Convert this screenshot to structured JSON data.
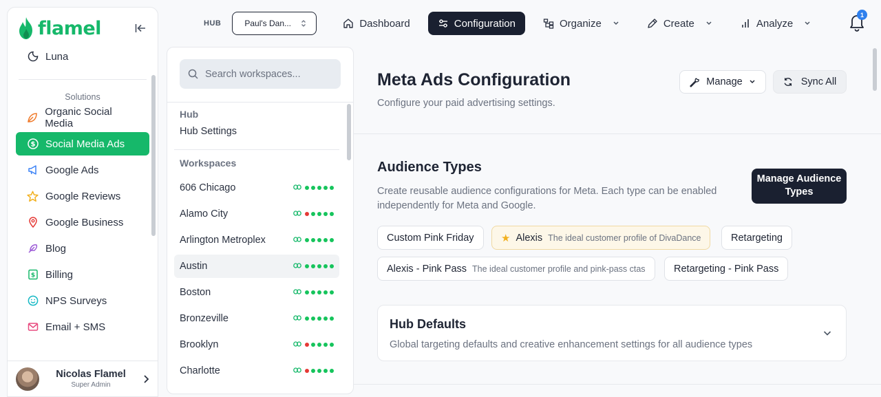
{
  "brand": {
    "name": "flamel",
    "color": "#16b86a"
  },
  "sidebar": {
    "top_item": {
      "label": "Luna",
      "icon": "moon-icon"
    },
    "section_label": "Solutions",
    "items": [
      {
        "label": "Organic Social Media",
        "icon": "leaf-icon",
        "color": "#f07a2a"
      },
      {
        "label": "Social Media Ads",
        "icon": "dollar-icon",
        "active": true
      },
      {
        "label": "Google Ads",
        "icon": "megaphone-icon",
        "color": "#3b82f6"
      },
      {
        "label": "Google Reviews",
        "icon": "star-icon",
        "color": "#f2b01e"
      },
      {
        "label": "Google Business",
        "icon": "map-pin-icon",
        "color": "#e53935"
      },
      {
        "label": "Blog",
        "icon": "feather-icon",
        "color": "#9b59d6"
      },
      {
        "label": "Billing",
        "icon": "billing-icon",
        "color": "#16b86a"
      },
      {
        "label": "NPS Surveys",
        "icon": "smile-icon",
        "color": "#14b8c4"
      },
      {
        "label": "Email + SMS",
        "icon": "mail-icon",
        "color": "#e84a7f"
      }
    ],
    "user": {
      "name": "Nicolas Flamel",
      "role": "Super Admin"
    }
  },
  "topbar": {
    "hub_label": "HUB",
    "hub_value": "Paul's Dan...",
    "tabs": [
      {
        "label": "Dashboard",
        "icon": "home-icon"
      },
      {
        "label": "Configuration",
        "icon": "sliders-icon",
        "active": true
      },
      {
        "label": "Organize",
        "icon": "organize-icon",
        "dropdown": true
      },
      {
        "label": "Create",
        "icon": "pen-icon",
        "dropdown": true
      },
      {
        "label": "Analyze",
        "icon": "bar-chart-icon",
        "dropdown": true
      }
    ],
    "notifications": "1"
  },
  "workspace_panel": {
    "search_placeholder": "Search workspaces...",
    "hub_heading": "Hub",
    "hub_settings": "Hub Settings",
    "workspaces_heading": "Workspaces",
    "workspaces": [
      {
        "name": "606 Chicago",
        "dots": [
          "green",
          "green",
          "green",
          "green",
          "green"
        ]
      },
      {
        "name": "Alamo City",
        "dots": [
          "red",
          "green",
          "green",
          "green",
          "green"
        ]
      },
      {
        "name": "Arlington Metroplex",
        "dots": [
          "green",
          "green",
          "green",
          "green",
          "green"
        ]
      },
      {
        "name": "Austin",
        "dots": [
          "green",
          "green",
          "green",
          "green",
          "green"
        ],
        "highlighted": true
      },
      {
        "name": "Boston",
        "dots": [
          "green",
          "green",
          "green",
          "green",
          "green"
        ]
      },
      {
        "name": "Bronzeville",
        "dots": [
          "green",
          "green",
          "green",
          "green",
          "green"
        ]
      },
      {
        "name": "Brooklyn",
        "dots": [
          "red",
          "green",
          "green",
          "green",
          "green"
        ]
      },
      {
        "name": "Charlotte",
        "dots": [
          "red",
          "green",
          "green",
          "green",
          "green"
        ]
      }
    ]
  },
  "main": {
    "title": "Meta Ads Configuration",
    "subtitle": "Configure your paid advertising settings.",
    "manage_label": "Manage",
    "sync_label": "Sync All",
    "audience": {
      "title": "Audience Types",
      "description": "Create reusable audience configurations for Meta. Each type can be enabled independently for Meta and Google.",
      "manage_btn": "Manage Audience Types",
      "chips": [
        {
          "label": "Custom Pink Friday",
          "desc": ""
        },
        {
          "label": "Alexis",
          "desc": "The ideal customer profile of DivaDance",
          "starred": true
        },
        {
          "label": "Retargeting",
          "desc": ""
        },
        {
          "label": "Alexis - Pink Pass",
          "desc": "The ideal customer profile and pink-pass ctas"
        },
        {
          "label": "Retargeting - Pink Pass",
          "desc": ""
        }
      ]
    },
    "hub_defaults": {
      "title": "Hub Defaults",
      "subtitle": "Global targeting defaults and creative enhancement settings for all audience types"
    }
  }
}
